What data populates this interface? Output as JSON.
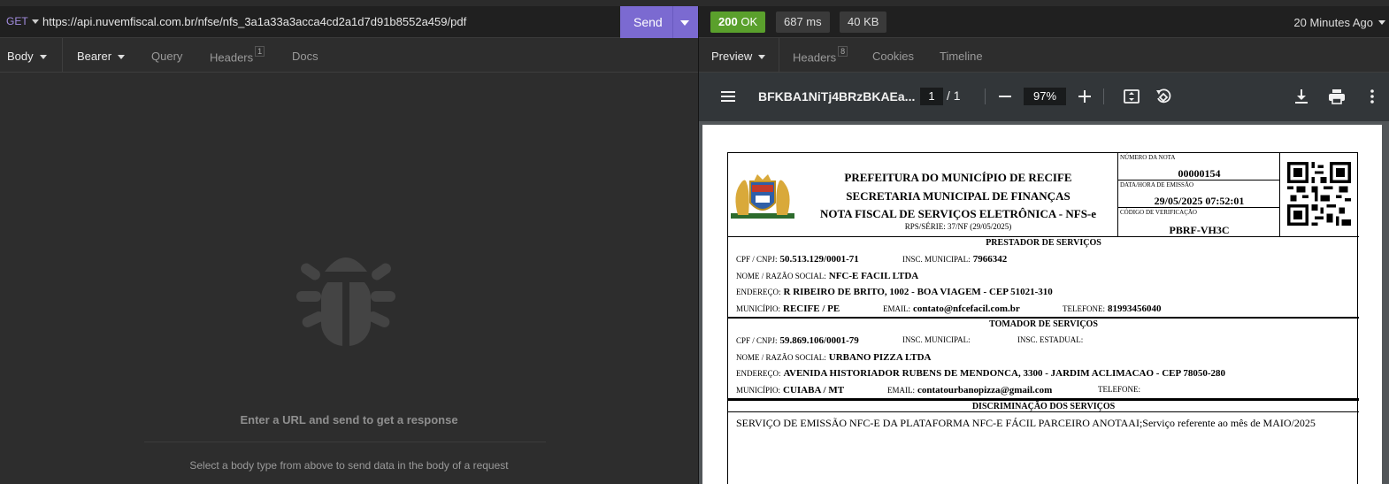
{
  "request": {
    "method": "GET",
    "url": "https://api.nuvemfiscal.com.br/nfse/nfs_3a1a33a3acca4cd2a1d7d91b8552a459/pdf",
    "send_label": "Send",
    "tabs": {
      "body": "Body",
      "auth": "Bearer",
      "query": "Query",
      "headers": "Headers",
      "headers_count": "1",
      "docs": "Docs"
    },
    "empty_title": "Enter a URL and send to get a response",
    "empty_sub": "Select a body type from above to send data in the body of a request"
  },
  "response": {
    "status_code": "200",
    "status_text": "OK",
    "time": "687 ms",
    "size": "40 KB",
    "ago": "20 Minutes Ago",
    "tabs": {
      "preview": "Preview",
      "headers": "Headers",
      "headers_count": "8",
      "cookies": "Cookies",
      "timeline": "Timeline"
    }
  },
  "pdf": {
    "filename": "BFKBA1NiTj4BRzBKAEa...",
    "page": "1",
    "page_total": "/ 1",
    "zoom": "97%"
  },
  "invoice": {
    "title1": "PREFEITURA DO MUNICÍPIO DE RECIFE",
    "title2": "SECRETARIA MUNICIPAL DE FINANÇAS",
    "title3": "NOTA FISCAL DE SERVIÇOS ELETRÔNICA - NFS-e",
    "rps": "RPS/SÉRIE: 37/NF (29/05/2025)",
    "numero_label": "NÚMERO DA NOTA",
    "numero": "00000154",
    "data_label": "DATA/HORA DE EMISSÃO",
    "data": "29/05/2025 07:52:01",
    "codigo_label": "CÓDIGO DE VERIFICAÇÃO",
    "codigo": "PBRF-VH3C",
    "prestador_title": "PRESTADOR DE SERVIÇOS",
    "prestador": {
      "cnpj_label": "CPF / CNPJ:",
      "cnpj": "50.513.129/0001-71",
      "im_label": "INSC. MUNICIPAL:",
      "im": "7966342",
      "nome_label": "NOME / RAZÃO SOCIAL:",
      "nome": "NFC-E FACIL LTDA",
      "end_label": "ENDEREÇO:",
      "end": "R RIBEIRO DE BRITO, 1002 - BOA VIAGEM - CEP 51021-310",
      "mun_label": "MUNICÍPIO:",
      "mun": "RECIFE / PE",
      "email_label": "EMAIL:",
      "email": "contato@nfcefacil.com.br",
      "tel_label": "TELEFONE:",
      "tel": "81993456040"
    },
    "tomador_title": "TOMADOR DE SERVIÇOS",
    "tomador": {
      "cnpj_label": "CPF / CNPJ:",
      "cnpj": "59.869.106/0001-79",
      "im_label": "INSC. MUNICIPAL:",
      "ie_label": "INSC. ESTADUAL:",
      "nome_label": "NOME / RAZÃO SOCIAL:",
      "nome": "URBANO PIZZA LTDA",
      "end_label": "ENDEREÇO:",
      "end": "AVENIDA HISTORIADOR RUBENS DE MENDONCA, 3300 - JARDIM ACLIMACAO - CEP 78050-280",
      "mun_label": "MUNICÍPIO:",
      "mun": "CUIABA / MT",
      "email_label": "EMAIL:",
      "email": "contatourbanopizza@gmail.com",
      "tel_label": "TELEFONE:"
    },
    "disc_title": "DISCRIMINAÇÃO DOS SERVIÇOS",
    "disc_text": "SERVIÇO DE EMISSÃO NFC-E DA PLATAFORMA NFC-E FÁCIL PARCEIRO ANOTAAI;Serviço referente ao mês de MAIO/2025"
  },
  "colors": {
    "accent": "#7b6ad1",
    "ok": "#5aa02c"
  }
}
